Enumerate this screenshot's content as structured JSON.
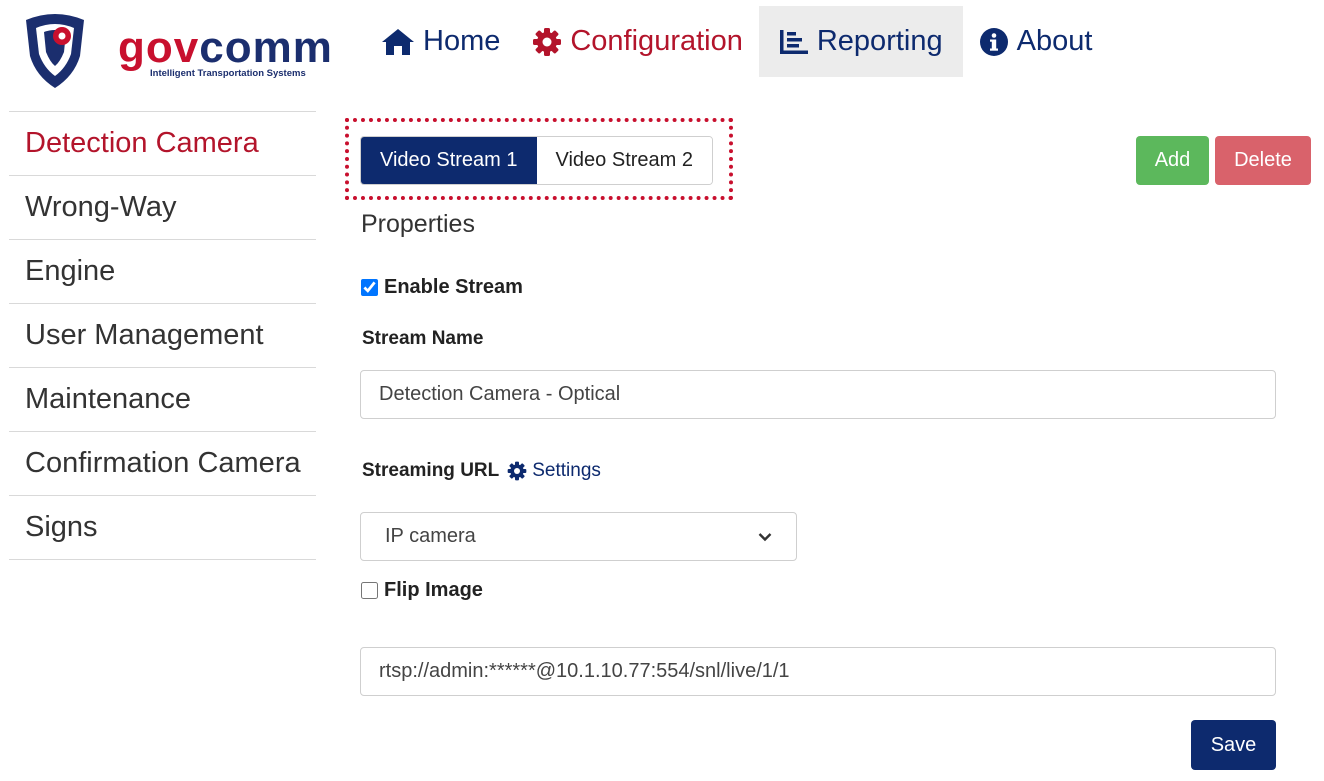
{
  "brand": {
    "name_part1": "gov",
    "name_part2": "comm",
    "tagline": "Intelligent Transportation Systems",
    "colors": {
      "red": "#c8102e",
      "navy": "#1b2e6e"
    }
  },
  "topnav": {
    "items": [
      {
        "label": "Home",
        "icon": "home-icon"
      },
      {
        "label": "Configuration",
        "icon": "gear-icon"
      },
      {
        "label": "Reporting",
        "icon": "chart-icon",
        "active": true
      },
      {
        "label": "About",
        "icon": "info-icon"
      }
    ]
  },
  "sidebar": {
    "items": [
      {
        "label": "Detection Camera",
        "active": true
      },
      {
        "label": "Wrong-Way"
      },
      {
        "label": "Engine"
      },
      {
        "label": "User Management"
      },
      {
        "label": "Maintenance"
      },
      {
        "label": "Confirmation Camera"
      },
      {
        "label": "Signs"
      }
    ]
  },
  "stream_tabs": [
    {
      "label": "Video Stream 1",
      "active": true
    },
    {
      "label": "Video Stream 2"
    }
  ],
  "actions": {
    "add": "Add",
    "delete": "Delete",
    "save": "Save"
  },
  "form": {
    "section_title": "Properties",
    "enable_stream": {
      "label": "Enable Stream",
      "checked": true
    },
    "stream_name": {
      "label": "Stream Name",
      "value": "Detection Camera - Optical"
    },
    "streaming_url": {
      "label": "Streaming URL",
      "settings_label": "Settings"
    },
    "source_select": {
      "value": "IP camera"
    },
    "flip_image": {
      "label": "Flip Image",
      "checked": false
    },
    "url_value": "rtsp://admin:******@10.1.10.77:554/snl/live/1/1"
  },
  "colors": {
    "accent_navy": "#0d2a6e",
    "accent_red": "#b3142b",
    "add_green": "#5cb85c",
    "delete_red": "#d9626b",
    "highlight": "#c8102e"
  }
}
